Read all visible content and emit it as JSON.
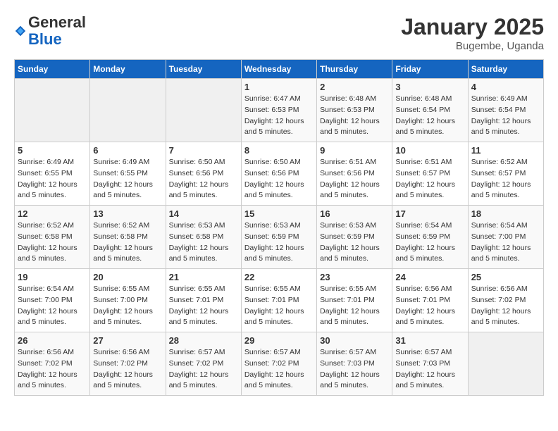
{
  "header": {
    "logo_general": "General",
    "logo_blue": "Blue",
    "month_title": "January 2025",
    "subtitle": "Bugembe, Uganda"
  },
  "days_of_week": [
    "Sunday",
    "Monday",
    "Tuesday",
    "Wednesday",
    "Thursday",
    "Friday",
    "Saturday"
  ],
  "weeks": [
    [
      {
        "day": "",
        "info": ""
      },
      {
        "day": "",
        "info": ""
      },
      {
        "day": "",
        "info": ""
      },
      {
        "day": "1",
        "info": "Sunrise: 6:47 AM\nSunset: 6:53 PM\nDaylight: 12 hours\nand 5 minutes."
      },
      {
        "day": "2",
        "info": "Sunrise: 6:48 AM\nSunset: 6:53 PM\nDaylight: 12 hours\nand 5 minutes."
      },
      {
        "day": "3",
        "info": "Sunrise: 6:48 AM\nSunset: 6:54 PM\nDaylight: 12 hours\nand 5 minutes."
      },
      {
        "day": "4",
        "info": "Sunrise: 6:49 AM\nSunset: 6:54 PM\nDaylight: 12 hours\nand 5 minutes."
      }
    ],
    [
      {
        "day": "5",
        "info": "Sunrise: 6:49 AM\nSunset: 6:55 PM\nDaylight: 12 hours\nand 5 minutes."
      },
      {
        "day": "6",
        "info": "Sunrise: 6:49 AM\nSunset: 6:55 PM\nDaylight: 12 hours\nand 5 minutes."
      },
      {
        "day": "7",
        "info": "Sunrise: 6:50 AM\nSunset: 6:56 PM\nDaylight: 12 hours\nand 5 minutes."
      },
      {
        "day": "8",
        "info": "Sunrise: 6:50 AM\nSunset: 6:56 PM\nDaylight: 12 hours\nand 5 minutes."
      },
      {
        "day": "9",
        "info": "Sunrise: 6:51 AM\nSunset: 6:56 PM\nDaylight: 12 hours\nand 5 minutes."
      },
      {
        "day": "10",
        "info": "Sunrise: 6:51 AM\nSunset: 6:57 PM\nDaylight: 12 hours\nand 5 minutes."
      },
      {
        "day": "11",
        "info": "Sunrise: 6:52 AM\nSunset: 6:57 PM\nDaylight: 12 hours\nand 5 minutes."
      }
    ],
    [
      {
        "day": "12",
        "info": "Sunrise: 6:52 AM\nSunset: 6:58 PM\nDaylight: 12 hours\nand 5 minutes."
      },
      {
        "day": "13",
        "info": "Sunrise: 6:52 AM\nSunset: 6:58 PM\nDaylight: 12 hours\nand 5 minutes."
      },
      {
        "day": "14",
        "info": "Sunrise: 6:53 AM\nSunset: 6:58 PM\nDaylight: 12 hours\nand 5 minutes."
      },
      {
        "day": "15",
        "info": "Sunrise: 6:53 AM\nSunset: 6:59 PM\nDaylight: 12 hours\nand 5 minutes."
      },
      {
        "day": "16",
        "info": "Sunrise: 6:53 AM\nSunset: 6:59 PM\nDaylight: 12 hours\nand 5 minutes."
      },
      {
        "day": "17",
        "info": "Sunrise: 6:54 AM\nSunset: 6:59 PM\nDaylight: 12 hours\nand 5 minutes."
      },
      {
        "day": "18",
        "info": "Sunrise: 6:54 AM\nSunset: 7:00 PM\nDaylight: 12 hours\nand 5 minutes."
      }
    ],
    [
      {
        "day": "19",
        "info": "Sunrise: 6:54 AM\nSunset: 7:00 PM\nDaylight: 12 hours\nand 5 minutes."
      },
      {
        "day": "20",
        "info": "Sunrise: 6:55 AM\nSunset: 7:00 PM\nDaylight: 12 hours\nand 5 minutes."
      },
      {
        "day": "21",
        "info": "Sunrise: 6:55 AM\nSunset: 7:01 PM\nDaylight: 12 hours\nand 5 minutes."
      },
      {
        "day": "22",
        "info": "Sunrise: 6:55 AM\nSunset: 7:01 PM\nDaylight: 12 hours\nand 5 minutes."
      },
      {
        "day": "23",
        "info": "Sunrise: 6:55 AM\nSunset: 7:01 PM\nDaylight: 12 hours\nand 5 minutes."
      },
      {
        "day": "24",
        "info": "Sunrise: 6:56 AM\nSunset: 7:01 PM\nDaylight: 12 hours\nand 5 minutes."
      },
      {
        "day": "25",
        "info": "Sunrise: 6:56 AM\nSunset: 7:02 PM\nDaylight: 12 hours\nand 5 minutes."
      }
    ],
    [
      {
        "day": "26",
        "info": "Sunrise: 6:56 AM\nSunset: 7:02 PM\nDaylight: 12 hours\nand 5 minutes."
      },
      {
        "day": "27",
        "info": "Sunrise: 6:56 AM\nSunset: 7:02 PM\nDaylight: 12 hours\nand 5 minutes."
      },
      {
        "day": "28",
        "info": "Sunrise: 6:57 AM\nSunset: 7:02 PM\nDaylight: 12 hours\nand 5 minutes."
      },
      {
        "day": "29",
        "info": "Sunrise: 6:57 AM\nSunset: 7:02 PM\nDaylight: 12 hours\nand 5 minutes."
      },
      {
        "day": "30",
        "info": "Sunrise: 6:57 AM\nSunset: 7:03 PM\nDaylight: 12 hours\nand 5 minutes."
      },
      {
        "day": "31",
        "info": "Sunrise: 6:57 AM\nSunset: 7:03 PM\nDaylight: 12 hours\nand 5 minutes."
      },
      {
        "day": "",
        "info": ""
      }
    ]
  ]
}
